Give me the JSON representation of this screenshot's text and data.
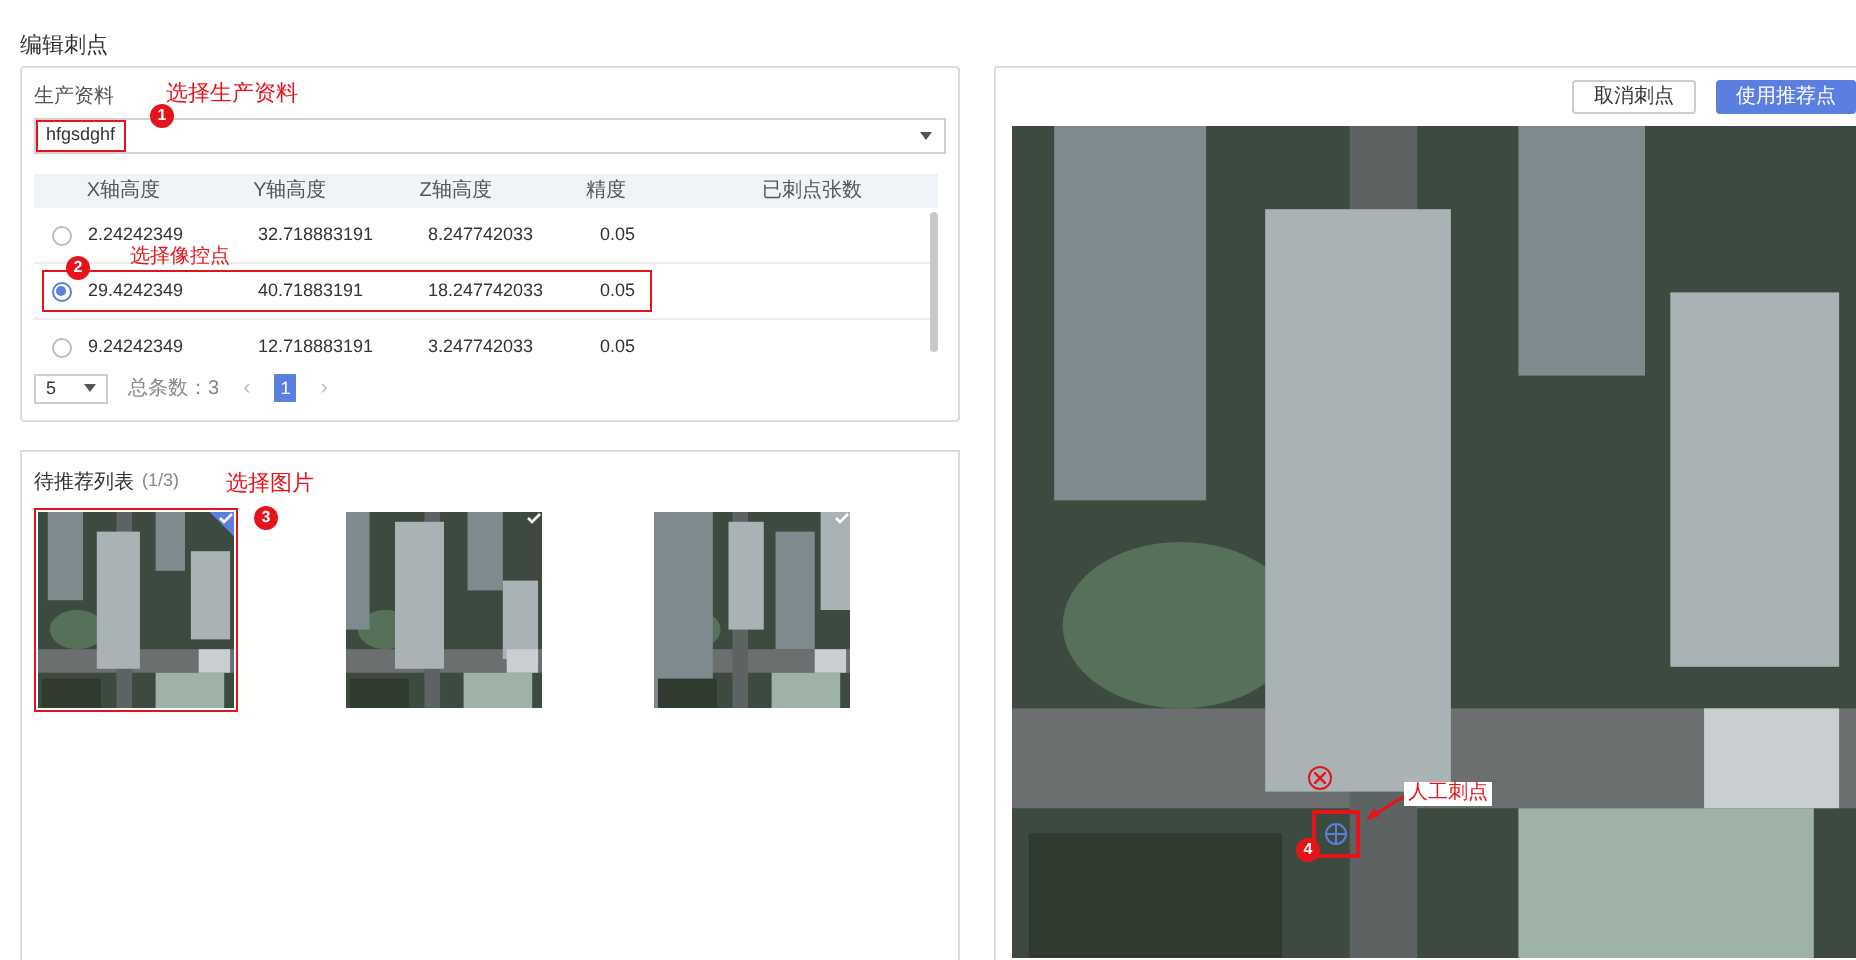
{
  "page_title": "编辑刺点",
  "production": {
    "label": "生产资料",
    "select_value": "hfgsdghf",
    "annotation": {
      "number": "1",
      "text": "选择生产资料"
    },
    "table": {
      "columns": [
        "X轴高度",
        "Y轴高度",
        "Z轴高度",
        "精度",
        "已刺点张数"
      ],
      "annotation": {
        "number": "2",
        "text": "选择像控点"
      },
      "rows": [
        {
          "selected": false,
          "cells": [
            "2.24242349",
            "32.718883191",
            "8.247742033",
            "0.05"
          ]
        },
        {
          "selected": true,
          "cells": [
            "29.4242349",
            "40.71883191",
            "18.247742033",
            "0.05"
          ]
        },
        {
          "selected": false,
          "cells": [
            "9.24242349",
            "12.718883191",
            "3.247742033",
            "0.05"
          ]
        }
      ]
    },
    "pagination": {
      "page_size": "5",
      "total": "总条数：3",
      "prev": "‹",
      "next": "›",
      "pages": [
        {
          "label": "1",
          "selected": true
        }
      ]
    }
  },
  "candidates": {
    "title": "待推荐列表",
    "count": "(1/3)",
    "annotation": {
      "number": "3",
      "text": "选择图片"
    },
    "images": [
      {
        "kind": "picture",
        "selected": true
      },
      {
        "kind": "picture",
        "selected": false
      },
      {
        "kind": "picture",
        "selected": false
      }
    ]
  },
  "viewer": {
    "buttons": [
      {
        "label": "取消刺点",
        "primary": false
      },
      {
        "label": "使用推荐点",
        "primary": true
      }
    ],
    "marker": {
      "label": "人工刺点",
      "number": "4"
    }
  }
}
